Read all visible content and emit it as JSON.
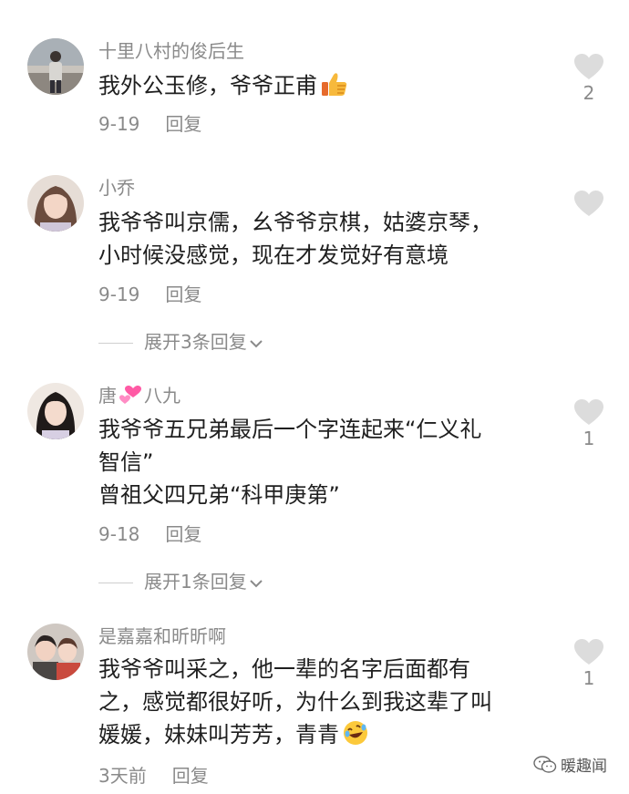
{
  "comments": [
    {
      "username": "十里八村的俊后生",
      "lines": [
        "我外公玉修，爷爷正甫"
      ],
      "date": "9-19",
      "reply_label": "回复",
      "likes": "2",
      "inline_emoji": "thumbs-up"
    },
    {
      "username": "小乔",
      "lines": [
        "我爷爷叫京儒，幺爷爷京棋，姑婆京琴，",
        "小时候没感觉，现在才发觉好有意境"
      ],
      "date": "9-19",
      "reply_label": "回复",
      "likes": "",
      "expand_label": "展开3条回复"
    },
    {
      "username_prefix": "唐",
      "username_suffix": "八九",
      "username_emoji": "two-hearts",
      "lines": [
        "我爷爷五兄弟最后一个字连起来“仁义礼",
        "智信”",
        "曾祖父四兄弟“科甲庚第”"
      ],
      "date": "9-18",
      "reply_label": "回复",
      "likes": "1",
      "expand_label": "展开1条回复"
    },
    {
      "username": "是嘉嘉和昕昕啊",
      "lines": [
        "我爷爷叫采之，他一辈的名字后面都有",
        "之，感觉都很好听，为什么到我这辈了叫",
        "媛媛，妹妹叫芳芳，青青"
      ],
      "date": "3天前",
      "reply_label": "回复",
      "likes": "1",
      "inline_emoji": "rolling-laughing"
    }
  ],
  "watermark": {
    "text": "暖趣闻",
    "icon": "wechat-icon"
  },
  "colors": {
    "text": "#1f1f1f",
    "meta": "#8a8a8a",
    "heart": "#dcdcdc"
  }
}
